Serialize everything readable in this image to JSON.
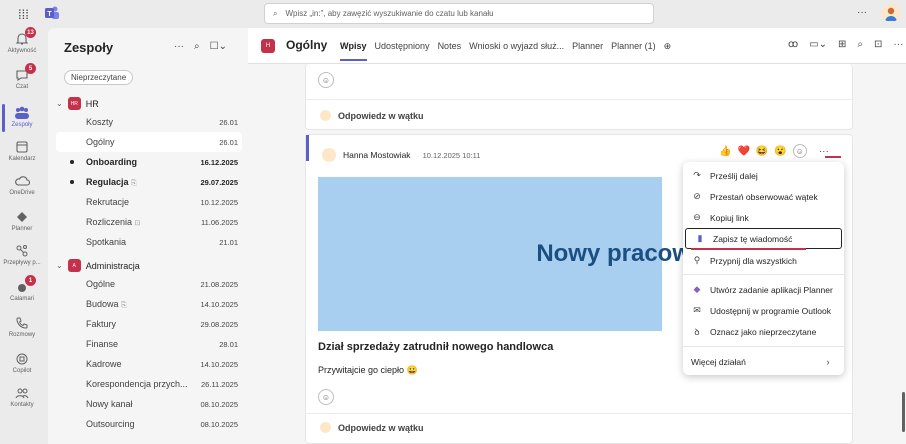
{
  "topbar": {
    "search_placeholder": "Wpisz „in:”, aby zawęzić wyszukiwanie do czatu lub kanału",
    "more": "···"
  },
  "rail": [
    {
      "label": "Aktywność",
      "icon": "bell-icon",
      "badge": "13"
    },
    {
      "label": "Czat",
      "icon": "chat-icon",
      "badge": "5"
    },
    {
      "label": "Zespoły",
      "icon": "teams-icon",
      "badge": ""
    },
    {
      "label": "Kalendarz",
      "icon": "calendar-icon",
      "badge": ""
    },
    {
      "label": "OneDrive",
      "icon": "cloud-icon",
      "badge": ""
    },
    {
      "label": "Planner",
      "icon": "planner-icon",
      "badge": ""
    },
    {
      "label": "Przepływy p...",
      "icon": "flow-icon",
      "badge": ""
    },
    {
      "label": "Calamari",
      "icon": "calamari-icon",
      "badge": "1"
    },
    {
      "label": "Rozmowy",
      "icon": "phone-icon",
      "badge": ""
    },
    {
      "label": "Copilot",
      "icon": "copilot-icon",
      "badge": ""
    },
    {
      "label": "Kontakty",
      "icon": "contacts-icon",
      "badge": ""
    }
  ],
  "panel": {
    "title": "Zespoły",
    "filter": "Nieprzeczytane"
  },
  "teams": [
    {
      "name": "HR",
      "badge": "HR",
      "channels": [
        {
          "name": "Koszty",
          "date": "26.01"
        },
        {
          "name": "Ogólny",
          "date": "26.01"
        },
        {
          "name": "Onboarding",
          "date": "16.12.2025"
        },
        {
          "name": "Regulacja",
          "date": "29.07.2025"
        },
        {
          "name": "Rekrutacje",
          "date": "10.12.2025"
        },
        {
          "name": "Rozliczenia",
          "date": "11.06.2025"
        },
        {
          "name": "Spotkania",
          "date": "21.01"
        }
      ]
    },
    {
      "name": "Administracja",
      "badge": "A",
      "channels": [
        {
          "name": "Ogólne",
          "date": "21.08.2025"
        },
        {
          "name": "Budowa",
          "date": "14.10.2025"
        },
        {
          "name": "Faktury",
          "date": "29.08.2025"
        },
        {
          "name": "Finanse",
          "date": "28.01"
        },
        {
          "name": "Kadrowe",
          "date": "14.10.2025"
        },
        {
          "name": "Korespondencja przych...",
          "date": "26.11.2025"
        },
        {
          "name": "Nowy kanał",
          "date": "08.10.2025"
        },
        {
          "name": "Outsourcing",
          "date": "08.10.2025"
        }
      ]
    }
  ],
  "channel": {
    "badge": "H",
    "name": "Ogólny",
    "tabs": [
      "Wpisy",
      "Udostępniony",
      "Notes",
      "Wnioski o wyjazd służ...",
      "Planner",
      "Planner (1)"
    ]
  },
  "post": {
    "author": "Hanna Mostowiak",
    "time": "10.12.2025 10:11",
    "hero_text": "Nowy pracownik!",
    "title": "Dział sprzedaży zatrudnił nowego handlowca",
    "body": "Przywitajcie go ciepło 😀",
    "reply": "Odpowiedz w wątku"
  },
  "prev_reply": "Odpowiedz w wątku",
  "reactions": [
    "👍",
    "❤️",
    "😆",
    "😮"
  ],
  "menu": [
    {
      "label": "Prześlij dalej",
      "icon": "forward-icon"
    },
    {
      "label": "Przestań obserwować wątek",
      "icon": "unfollow-icon"
    },
    {
      "label": "Kopiuj link",
      "icon": "link-icon"
    },
    {
      "label": "Zapisz tę wiadomość",
      "icon": "bookmark-icon"
    },
    {
      "label": "Przypnij dla wszystkich",
      "icon": "pin-icon"
    },
    {
      "label": "Utwórz zadanie aplikacji Planner",
      "icon": "planner-icon"
    },
    {
      "label": "Udostępnij w programie Outlook",
      "icon": "outlook-icon"
    },
    {
      "label": "Oznacz jako nieprzeczytane",
      "icon": "unread-icon"
    },
    {
      "label": "Więcej działań",
      "icon": "chevron-right-icon"
    }
  ]
}
